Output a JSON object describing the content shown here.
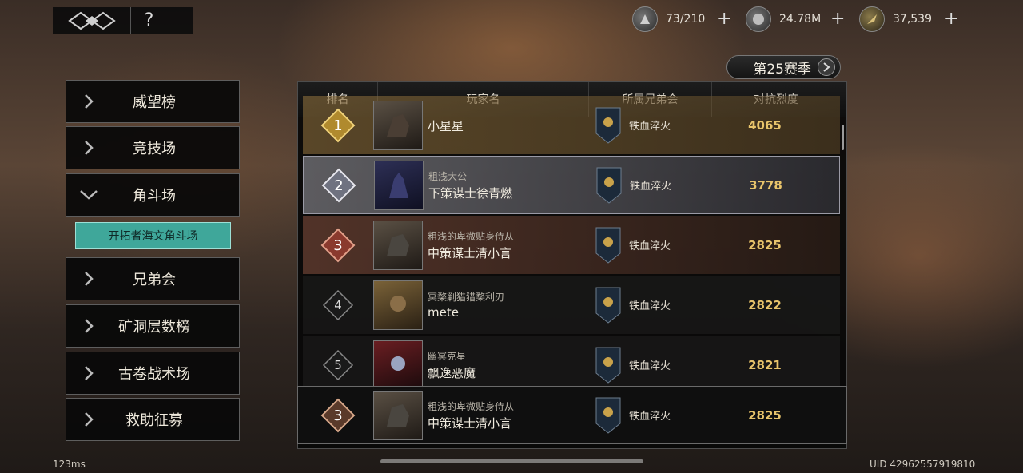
{
  "topbar": {
    "help_label": "?",
    "currencies": [
      {
        "icon": "stamina-icon",
        "value": "73/210",
        "plus": "+"
      },
      {
        "icon": "silver-coin-icon",
        "value": "24.78M",
        "plus": "+"
      },
      {
        "icon": "gold-feather-icon",
        "value": "37,539",
        "plus": "+"
      }
    ]
  },
  "season": {
    "label": "第25赛季"
  },
  "menu": {
    "items": [
      {
        "label": "威望榜"
      },
      {
        "label": "竞技场"
      },
      {
        "label": "角斗场"
      },
      {
        "label": "兄弟会"
      },
      {
        "label": "矿洞层数榜"
      },
      {
        "label": "古卷战术场"
      },
      {
        "label": "救助征募"
      }
    ],
    "submenu_label": "开拓者海文角斗场"
  },
  "table": {
    "headers": [
      "排名",
      "玩家名",
      "所属兄弟会",
      "对抗烈度"
    ],
    "rows": [
      {
        "rank": "1",
        "title": "",
        "name": "小星星",
        "guild": "铁血淬火",
        "score": "4065"
      },
      {
        "rank": "2",
        "title": "粗浅大公",
        "name": "下策谋士徐青燃",
        "guild": "铁血淬火",
        "score": "3778"
      },
      {
        "rank": "3",
        "title": "粗浅的卑微贴身侍从",
        "name": "中策谋士清小言",
        "guild": "铁血淬火",
        "score": "2825"
      },
      {
        "rank": "4",
        "title": "冥楘剿猎猎楘利刃",
        "name": "mete",
        "guild": "铁血淬火",
        "score": "2822"
      },
      {
        "rank": "5",
        "title": "幽冥克星",
        "name": "飘逸恶魔",
        "guild": "铁血淬火",
        "score": "2821"
      }
    ],
    "my_row": {
      "rank": "3",
      "title": "粗浅的卑微贴身侍从",
      "name": "中策谋士清小言",
      "guild": "铁血淬火",
      "score": "2825"
    }
  },
  "footer": {
    "ping": "123ms",
    "uid": "UID 42962557919810"
  }
}
